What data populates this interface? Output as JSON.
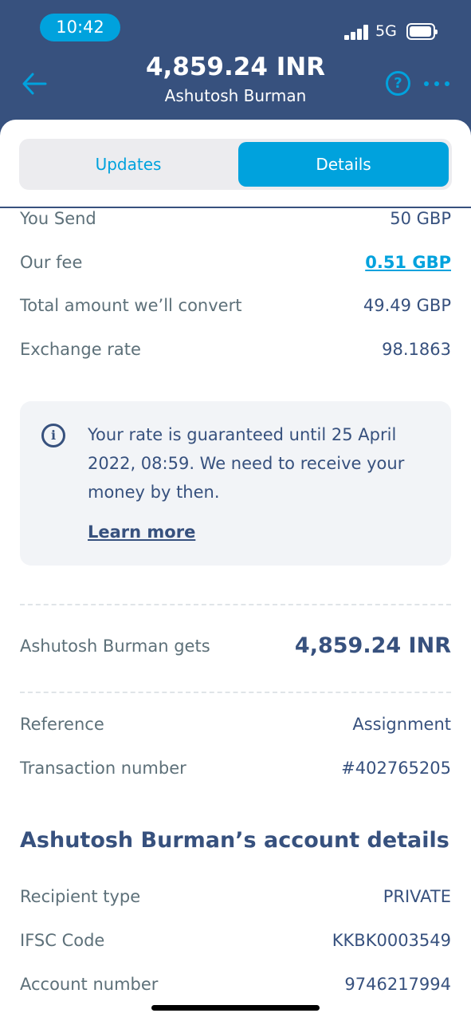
{
  "status_bar": {
    "time": "10:42",
    "network": "5G"
  },
  "header": {
    "amount": "4,859.24 INR",
    "recipient": "Ashutosh Burman",
    "help_glyph": "?"
  },
  "tabs": [
    {
      "label": "Updates",
      "selected": false
    },
    {
      "label": "Details",
      "selected": true
    }
  ],
  "details": [
    {
      "label": "You Send",
      "value": "50 GBP"
    },
    {
      "label": "Our fee",
      "value": "0.51 GBP"
    },
    {
      "label": "Total amount we’ll convert",
      "value": "49.49 GBP"
    },
    {
      "label": "Exchange rate",
      "value": "98.1863"
    }
  ],
  "rate_notice": {
    "icon_glyph": "i",
    "text": "Your rate is guaranteed until 25 April 2022, 08:59. We need to receive your money by then.",
    "link": "Learn more"
  },
  "recipient_gets": {
    "label": "Ashutosh Burman gets",
    "value": "4,859.24 INR"
  },
  "reference_rows": [
    {
      "label": "Reference",
      "value": "Assignment"
    },
    {
      "label": "Transaction number",
      "value": "#402765205"
    }
  ],
  "account_section": {
    "title": "Ashutosh Burman’s account details",
    "rows": [
      {
        "label": "Recipient type",
        "value": "PRIVATE"
      },
      {
        "label": "IFSC Code",
        "value": "KKBK0003549"
      },
      {
        "label": "Account number",
        "value": "9746217994"
      }
    ]
  },
  "colors": {
    "navy": "#37517e",
    "accent": "#00a2dd",
    "muted": "#5d7079",
    "panel": "#f2f4f7"
  },
  "icons": [
    "back-arrow-icon",
    "help-icon",
    "more-icon",
    "info-icon",
    "signal-icon",
    "battery-icon"
  ]
}
